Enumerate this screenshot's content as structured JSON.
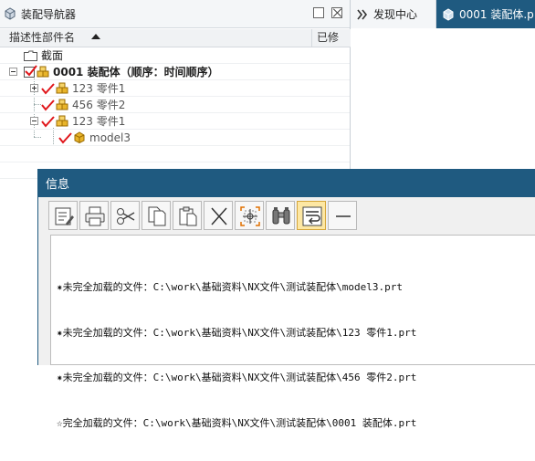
{
  "navigator": {
    "title": "装配导航器",
    "columns": [
      "描述性部件名",
      "已修"
    ],
    "tree": [
      {
        "label": "截面",
        "icon": "folder-icon",
        "level": 0
      },
      {
        "label": "0001 装配体（顺序：时间顺序）",
        "icon": "assembly-icon",
        "level": 0
      },
      {
        "label": "123 零件1",
        "icon": "assembly-icon",
        "level": 1
      },
      {
        "label": "456 零件2",
        "icon": "assembly-icon",
        "level": 1
      },
      {
        "label": "123 零件1",
        "icon": "assembly-icon",
        "level": 1
      },
      {
        "label": "model3",
        "icon": "part-icon",
        "level": 2
      }
    ]
  },
  "tabs": [
    {
      "label": "发现中心",
      "icon": "discover-icon"
    },
    {
      "label": "0001 装配体.p",
      "icon": "assembly-icon"
    }
  ],
  "dialog": {
    "title": "信息",
    "toolbar": [
      {
        "name": "save-icon"
      },
      {
        "name": "print-icon"
      },
      {
        "name": "cut-icon"
      },
      {
        "name": "copy-icon"
      },
      {
        "name": "paste-icon"
      },
      {
        "name": "delete-icon"
      },
      {
        "name": "fit-icon"
      },
      {
        "name": "find-icon"
      },
      {
        "name": "wrap-icon",
        "active": true
      },
      {
        "name": "minimize-icon"
      }
    ],
    "lines": [
      "✷未完全加载的文件：C:\\work\\基础资料\\NX文件\\测试装配体\\model3.prt",
      "✷未完全加载的文件：C:\\work\\基础资料\\NX文件\\测试装配体\\123 零件1.prt",
      "✷未完全加载的文件：C:\\work\\基础资料\\NX文件\\测试装配体\\456 零件2.prt",
      "☆完全加载的文件：C:\\work\\基础资料\\NX文件\\测试装配体\\0001 装配体.prt"
    ]
  },
  "colors": {
    "accent": "#1f5a80",
    "check": "#e0161b",
    "cube": "#e8b42a"
  }
}
